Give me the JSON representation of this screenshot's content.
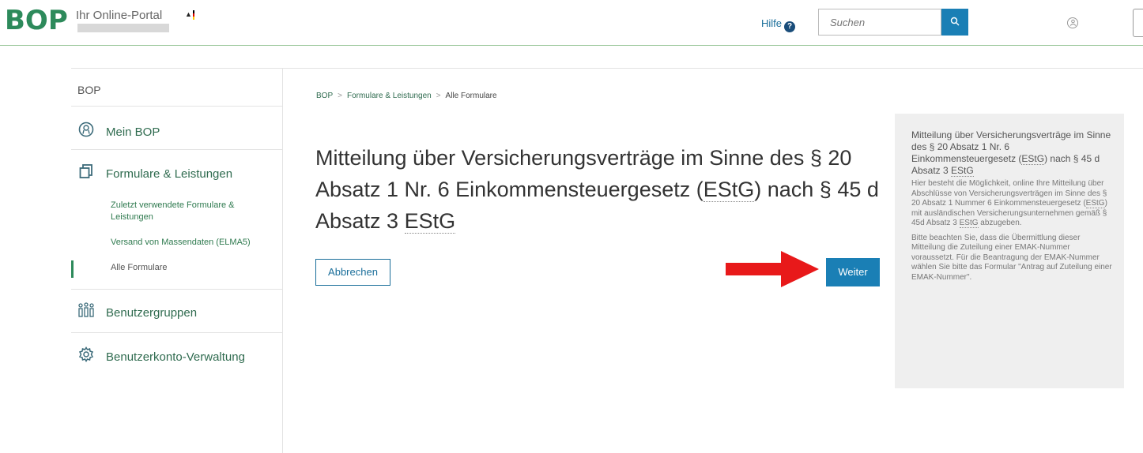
{
  "header": {
    "logo": "BOP",
    "portal_name": "Ihr Online-Portal",
    "help_label": "Hilfe",
    "help_icon": "?",
    "search_placeholder": "Suchen",
    "search_icon": "search-icon",
    "user_icon": "user-icon"
  },
  "sidebar": {
    "title": "BOP",
    "items": [
      {
        "label": "Mein BOP",
        "icon": "user-circle-icon"
      },
      {
        "label": "Formulare & Leistungen",
        "icon": "documents-icon"
      },
      {
        "label": "Benutzergruppen",
        "icon": "user-group-icon"
      },
      {
        "label": "Benutzerkonto-Verwaltung",
        "icon": "gear-icon"
      }
    ],
    "subitems": [
      {
        "label": "Zuletzt verwendete Formulare & Leistungen"
      },
      {
        "label": "Versand von Massendaten (ELMA5)"
      },
      {
        "label": "Alle Formulare",
        "active": true
      }
    ]
  },
  "breadcrumb": [
    "BOP",
    "Formulare & Leistungen",
    "Alle Formulare"
  ],
  "breadcrumb_separator": ">",
  "main": {
    "title_part1": "Mitteilung über Versicherungsverträge im Sinne des § 20 Absatz 1 Nr. 6 Einkommensteuergesetz (",
    "title_abbr1": "EStG",
    "title_part2": ") nach § 45 d Absatz 3 ",
    "title_abbr2": "EStG",
    "cancel_label": "Abbrechen",
    "next_label": "Weiter"
  },
  "info": {
    "title_part1": "Mitteilung über Versicherungsverträge im Sinne des § 20 Absatz 1 Nr. 6 Einkommensteuergesetz (",
    "title_abbr1": "EStG",
    "title_part2": ") nach § 45 d Absatz 3 ",
    "title_abbr2": "EStG",
    "para1_part1": "Hier besteht die Möglichkeit, online Ihre Mitteilung über Abschlüsse von Versicherungsverträgen im Sinne des § 20 Absatz 1 Nummer 6 Einkommensteuergesetz (",
    "para1_abbr1": "EStG",
    "para1_part2": ") mit ausländischen Versicherungsunternehmen gemäß § 45d Absatz 3 ",
    "para1_abbr2": "EStG",
    "para1_part3": " abzugeben.",
    "para2": "Bitte beachten Sie, dass die Übermittlung dieser Mitteilung die Zuteilung einer EMAK-Nummer voraussetzt. Für die Beantragung der EMAK-Nummer wählen Sie bitte das Formular \"Antrag auf Zuteilung einer EMAK-Nummer\"."
  },
  "colors": {
    "brand_green": "#2d8a5b",
    "primary_blue": "#1a7fb5",
    "annotation_arrow": "#e8191a"
  }
}
